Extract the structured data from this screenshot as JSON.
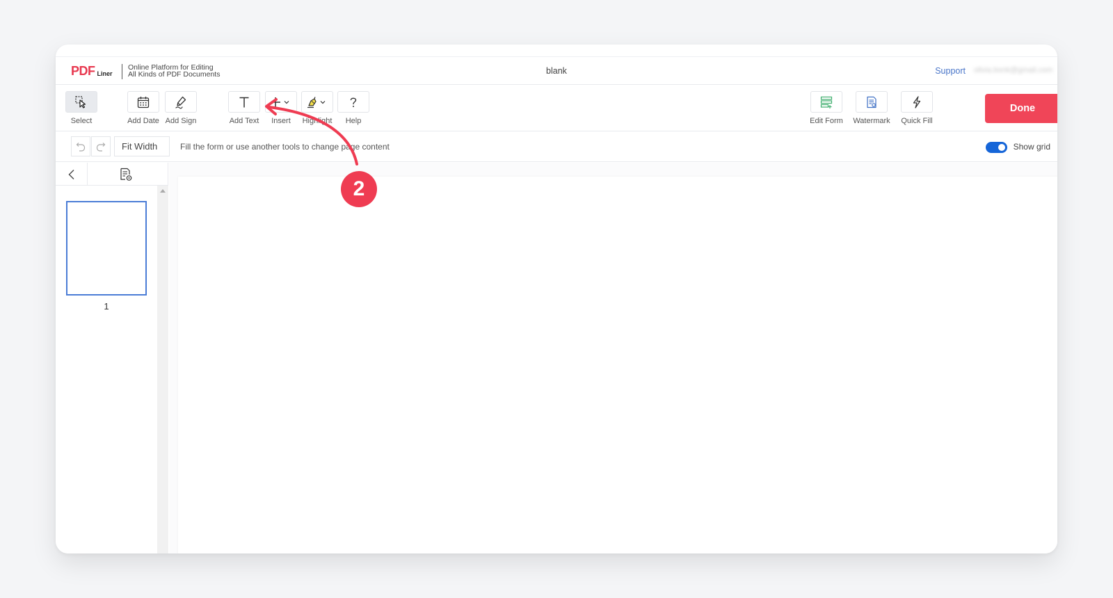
{
  "header": {
    "logo_main": "PDF",
    "logo_sub": "Liner",
    "tagline_line1": "Online Platform for Editing",
    "tagline_line2": "All Kinds of PDF Documents",
    "doc_title": "blank",
    "support_label": "Support",
    "user_email_blurred": "olivia.bonk@gmail.com"
  },
  "toolbar": {
    "tools": [
      {
        "label": "Select",
        "icon": "select-cursor-icon",
        "active": true
      },
      {
        "label": "Add Date",
        "icon": "calendar-icon"
      },
      {
        "label": "Add Sign",
        "icon": "signature-pen-icon"
      },
      {
        "label": "Add Text",
        "icon": "text-t-icon"
      },
      {
        "label": "Insert",
        "icon": "plus-icon"
      },
      {
        "label": "Highlight",
        "icon": "highlighter-icon"
      },
      {
        "label": "Help",
        "icon": "question-icon"
      },
      {
        "label": "Edit Form",
        "icon": "form-lines-icon"
      },
      {
        "label": "Watermark",
        "icon": "watermark-doc-icon"
      },
      {
        "label": "Quick Fill",
        "icon": "lightning-icon"
      }
    ],
    "done_label": "Done",
    "done_color": "#f04558"
  },
  "subbar": {
    "zoom_value": "Fit Width",
    "hint": "Fill the form or use another tools to change page content",
    "show_grid_label": "Show grid",
    "show_grid_enabled": true
  },
  "pages": {
    "current_page_number": "1"
  },
  "annotation": {
    "step_number": "2",
    "color": "#ef3c52"
  }
}
